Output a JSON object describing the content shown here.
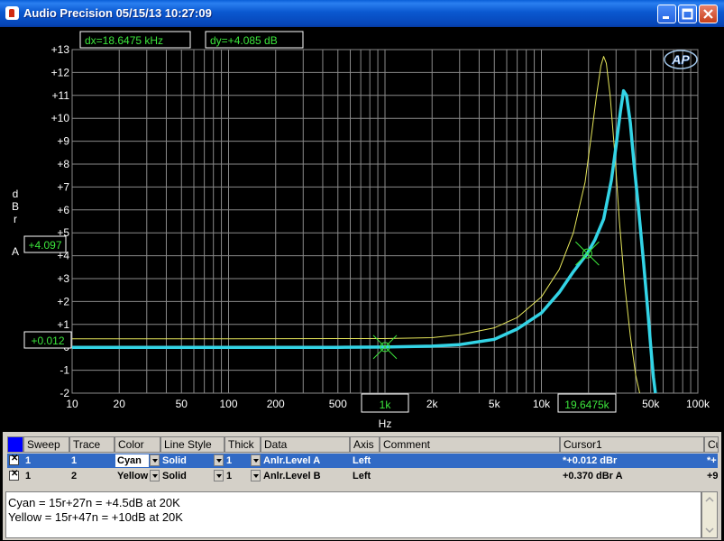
{
  "window": {
    "title": "Audio Precision  05/15/13 10:27:09"
  },
  "readouts": {
    "dx": "dx=18.6475 kHz",
    "dy": "dy=+4.085  dB"
  },
  "logo": "AP",
  "colors": {
    "cyan": "#33d4e6",
    "yellow": "#e6e65a",
    "grid": "#8a8a8a",
    "readout_text": "#3ce63c",
    "axis_text": "#ffffff"
  },
  "chart_data": {
    "type": "line",
    "xlabel": "Hz",
    "ylabel": "dBr A",
    "x_scale": "log",
    "xlim": [
      10,
      100000
    ],
    "ylim": [
      -2,
      13
    ],
    "grid": true,
    "x_ticks": [
      "10",
      "20",
      "50",
      "100",
      "200",
      "500",
      "1k",
      "2k",
      "5k",
      "10k",
      "19.6475k",
      "50k",
      "100k"
    ],
    "y_ticks": [
      "+13",
      "+12",
      "+11",
      "+10",
      "+9",
      "+8",
      "+7",
      "+6",
      "+5",
      "+4",
      "+3",
      "+2",
      "+1",
      "0",
      "-1",
      "-2"
    ],
    "cursor_x_label": "1k",
    "cursor_x2_label": "19.6475k",
    "cursor_y_label": "+0.012",
    "cursor_y2_label": "+4.097",
    "cursors": [
      {
        "x": 1000,
        "y": 0.012
      },
      {
        "x": 19647.5,
        "y": 4.097
      }
    ],
    "series": [
      {
        "color": "#e6e65a",
        "points": [
          [
            10,
            0.37
          ],
          [
            100,
            0.37
          ],
          [
            500,
            0.38
          ],
          [
            1000,
            0.38
          ],
          [
            2000,
            0.42
          ],
          [
            3000,
            0.55
          ],
          [
            5000,
            0.85
          ],
          [
            7000,
            1.3
          ],
          [
            10000,
            2.2
          ],
          [
            13000,
            3.4
          ],
          [
            16000,
            5.0
          ],
          [
            19000,
            7.2
          ],
          [
            21000,
            9.4
          ],
          [
            22500,
            11.0
          ],
          [
            24000,
            12.3
          ],
          [
            25000,
            12.7
          ],
          [
            26000,
            12.4
          ],
          [
            27500,
            11.0
          ],
          [
            29500,
            8.4
          ],
          [
            31500,
            5.5
          ],
          [
            34000,
            2.8
          ],
          [
            37000,
            0.5
          ],
          [
            40000,
            -1.2
          ],
          [
            42500,
            -2.0
          ]
        ]
      },
      {
        "color": "#33d4e6",
        "points": [
          [
            10,
            0.0
          ],
          [
            100,
            0.0
          ],
          [
            500,
            0.0
          ],
          [
            1000,
            0.012
          ],
          [
            2000,
            0.05
          ],
          [
            3000,
            0.12
          ],
          [
            5000,
            0.35
          ],
          [
            7000,
            0.8
          ],
          [
            10000,
            1.5
          ],
          [
            13000,
            2.4
          ],
          [
            16000,
            3.3
          ],
          [
            19647.5,
            4.097
          ],
          [
            22000,
            4.7
          ],
          [
            25000,
            5.6
          ],
          [
            28000,
            7.3
          ],
          [
            30000,
            8.8
          ],
          [
            32000,
            10.3
          ],
          [
            33500,
            11.2
          ],
          [
            35000,
            11.0
          ],
          [
            37000,
            9.8
          ],
          [
            39000,
            8.1
          ],
          [
            42000,
            5.9
          ],
          [
            45000,
            3.7
          ],
          [
            48000,
            1.5
          ],
          [
            50000,
            0.0
          ],
          [
            52000,
            -1.3
          ],
          [
            53500,
            -2.0
          ]
        ]
      }
    ]
  },
  "table": {
    "headers": [
      "Sweep",
      "Trace",
      "Color",
      "Line Style",
      "Thick",
      "Data",
      "Axis",
      "Comment",
      "Cursor1",
      "Cu"
    ],
    "rows": [
      {
        "sweep": "1",
        "trace": "1",
        "color": "Cyan",
        "style": "Solid",
        "thick": "1",
        "data": "Anlr.Level A",
        "axis": "Left",
        "comment": "",
        "cursor": "*+0.012  dBr",
        "more": "*+"
      },
      {
        "sweep": "1",
        "trace": "2",
        "color": "Yellow",
        "style": "Solid",
        "thick": "1",
        "data": "Anlr.Level B",
        "axis": "Left",
        "comment": "",
        "cursor": "+0.370  dBr A",
        "more": "+9"
      }
    ]
  },
  "notes": {
    "line1": "Cyan = 15r+27n = +4.5dB at 20K",
    "line2": "Yellow = 15r+47n = +10dB at 20K"
  }
}
